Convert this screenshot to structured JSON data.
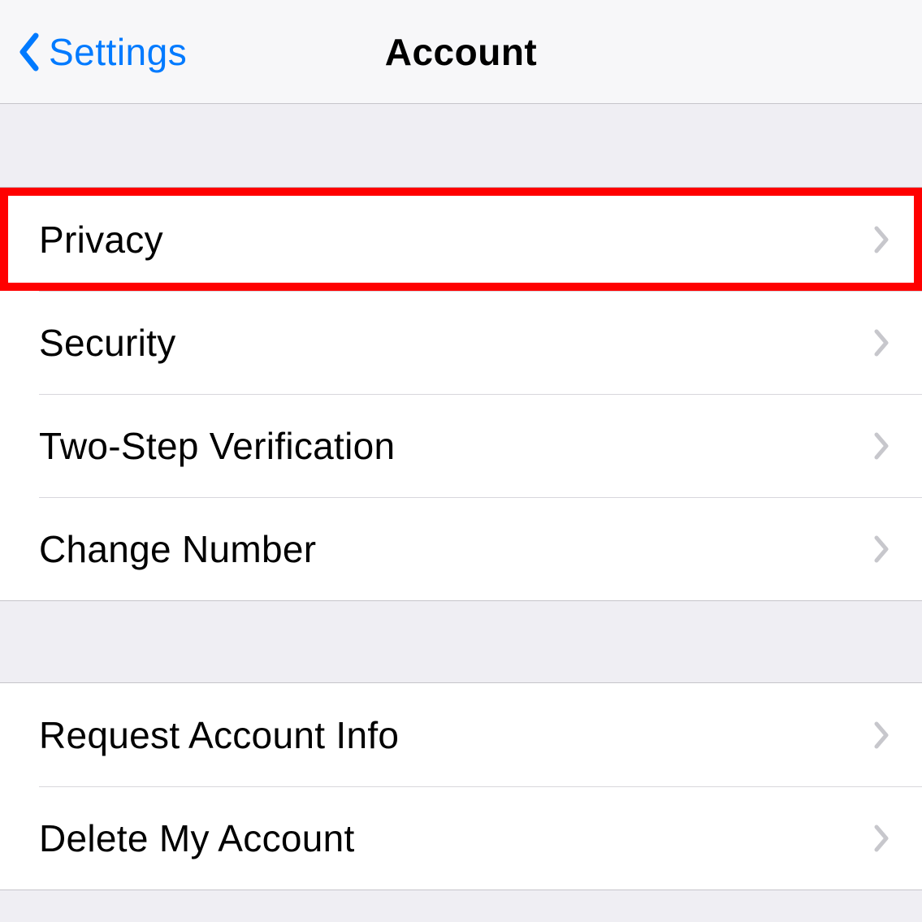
{
  "header": {
    "back_label": "Settings",
    "title": "Account"
  },
  "groups": [
    {
      "items": [
        {
          "label": "Privacy",
          "highlight": true
        },
        {
          "label": "Security"
        },
        {
          "label": "Two-Step Verification"
        },
        {
          "label": "Change Number"
        }
      ]
    },
    {
      "items": [
        {
          "label": "Request Account Info"
        },
        {
          "label": "Delete My Account"
        }
      ]
    }
  ],
  "colors": {
    "accent": "#007aff",
    "highlight": "#ff0000",
    "background": "#efeef3",
    "row_bg": "#ffffff",
    "separator": "#d8d7dc",
    "chevron": "#c7c7cc"
  }
}
